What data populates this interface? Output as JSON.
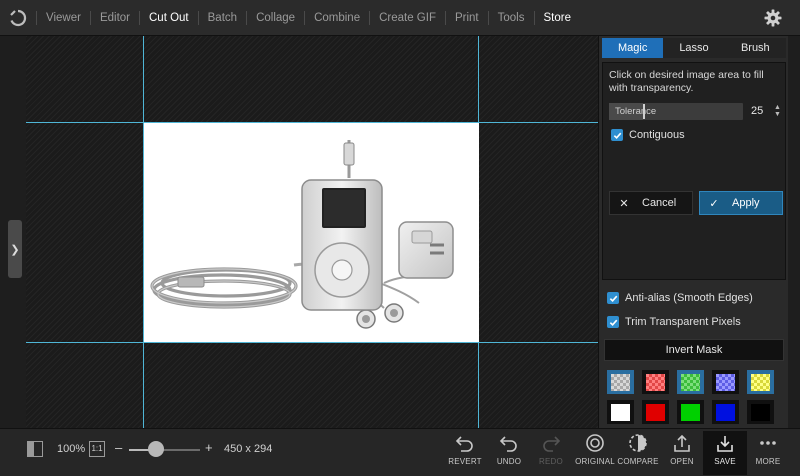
{
  "menu": {
    "items": [
      {
        "label": "Viewer"
      },
      {
        "label": "Editor"
      },
      {
        "label": "Cut Out"
      },
      {
        "label": "Batch"
      },
      {
        "label": "Collage"
      },
      {
        "label": "Combine"
      },
      {
        "label": "Create GIF"
      },
      {
        "label": "Print"
      },
      {
        "label": "Tools"
      },
      {
        "label": "Store"
      }
    ],
    "active": "Cut Out"
  },
  "panel": {
    "tabs": [
      {
        "label": "Magic Eraser",
        "active": true
      },
      {
        "label": "Lasso",
        "active": false
      },
      {
        "label": "Brush",
        "active": false
      }
    ],
    "hint": "Click on desired image area to fill with transparency.",
    "tolerance": {
      "label": "Tolerance",
      "value": "25",
      "fraction": 0.25
    },
    "contiguous": {
      "label": "Contiguous",
      "checked": true
    },
    "cancel_label": "Cancel",
    "apply_label": "Apply",
    "antialias": {
      "label": "Anti-alias (Smooth Edges)",
      "checked": true
    },
    "trim": {
      "label": "Trim Transparent Pixels",
      "checked": true
    },
    "invert_label": "Invert Mask",
    "swatches": [
      {
        "name": "checker-gray",
        "selected": true
      },
      {
        "name": "checker-red",
        "selected": false
      },
      {
        "name": "checker-green",
        "selected": true
      },
      {
        "name": "checker-blue",
        "selected": false
      },
      {
        "name": "checker-yellow",
        "selected": true
      },
      {
        "name": "white",
        "color": "#ffffff"
      },
      {
        "name": "red",
        "color": "#e00000"
      },
      {
        "name": "green",
        "color": "#00d000"
      },
      {
        "name": "blue",
        "color": "#0010e0"
      },
      {
        "name": "black",
        "color": "#000000"
      }
    ]
  },
  "bottom": {
    "zoom": "100%",
    "one_to_one": "1:1",
    "zoom_fraction": 0.38,
    "dimensions": "450 x 294",
    "actions": [
      {
        "label": "REVERT",
        "icon": "revert-icon",
        "enabled": true
      },
      {
        "label": "UNDO",
        "icon": "undo-icon",
        "enabled": true
      },
      {
        "label": "REDO",
        "icon": "redo-icon",
        "enabled": false
      },
      {
        "label": "ORIGINAL",
        "icon": "original-icon",
        "enabled": true
      },
      {
        "label": "COMPARE",
        "icon": "compare-icon",
        "enabled": true
      },
      {
        "label": "OPEN",
        "icon": "open-icon",
        "enabled": true
      },
      {
        "label": "SAVE",
        "icon": "save-icon",
        "enabled": true
      },
      {
        "label": "MORE",
        "icon": "more-icon",
        "enabled": true
      }
    ]
  },
  "colors": {
    "accent": "#1f6fb8",
    "guide": "#4fb6d6",
    "apply": "#1a5c86"
  }
}
